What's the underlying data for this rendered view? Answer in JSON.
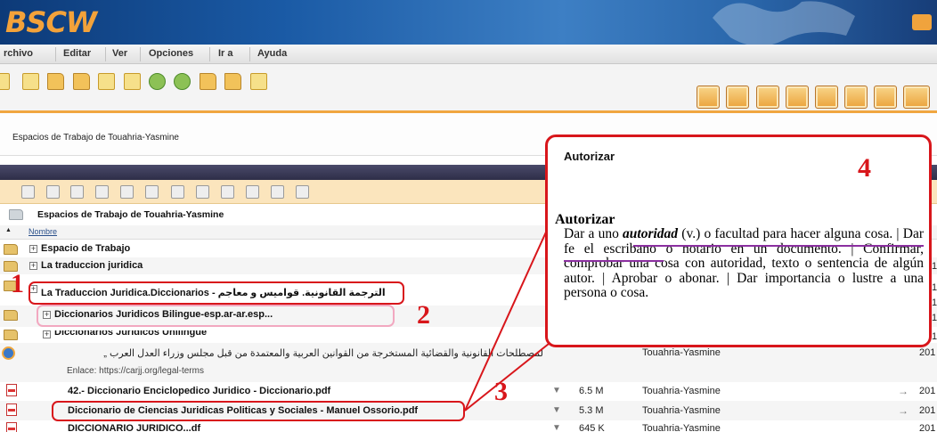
{
  "app": {
    "logo": "BSCW"
  },
  "menu": [
    "rchivo",
    "Editar",
    "Ver",
    "Opciones",
    "Ir a",
    "Ayuda"
  ],
  "breadcrumb": "Espacios de Trabajo de Touahria-Yasmine",
  "list": {
    "folder_title": "Espacios de Trabajo de Touahria-Yasmine",
    "column_name": "Nombre",
    "rows": [
      {
        "name": "Espacio de Trabajo"
      },
      {
        "name": "La traduccion juridica"
      },
      {
        "name": "La Traduccion Juridica.Diccionarios - الترجمة القانونية. قواميس و معاجم"
      },
      {
        "name": "Diccionarios Juridicos Bilingue-esp.ar-ar.esp..."
      },
      {
        "name": "Diccionarios Juridicos Unilingue"
      },
      {
        "name": "لمصطلحات القانونية والقضائية المستخرجة من القوانين العربية والمعتمدة من قبل مجلس وزراء العدل العرب „",
        "link_label": "Enlace: https://carjj.org/legal-terms",
        "owner": "Touahria-Yasmine",
        "date": "201"
      },
      {
        "name": "42.- Diccionario Enciclopedico Juridico - Diccionario.pdf",
        "size": "6.5 M",
        "owner": "Touahria-Yasmine",
        "date": "201"
      },
      {
        "name": "Diccionario de Ciencias Juridicas Politicas y Sociales - Manuel Ossorio.pdf",
        "size": "5.3 M",
        "owner": "Touahria-Yasmine",
        "date": "201"
      },
      {
        "name": "DICCIONARIO JURIDICO...df",
        "size": "645 K",
        "owner": "Touahria-Yasmine",
        "date": "201"
      }
    ],
    "right_edge_values": [
      "1",
      "1",
      "1",
      "1",
      "1"
    ]
  },
  "popup": {
    "header": "Autorizar",
    "term": "Autorizar",
    "definition_prefix": "Dar a uno ",
    "definition_italic": "autoridad",
    "definition_rest": " (v.) o facultad para hacer alguna cosa. | Dar fe el escribano o notario en un documento. | Confirmar, comprobar una cosa con autoridad, texto o sentencia de algún autor. | Aprobar o abonar. | Dar importancia o lustre a una persona o cosa."
  },
  "annotations": [
    "1",
    "2",
    "3",
    "4"
  ],
  "colors": {
    "accent_orange": "#f0a640",
    "annotation_red": "#d8161b",
    "annotation_pink": "#f2a8c0",
    "underline_purple": "#8b2fa0"
  }
}
